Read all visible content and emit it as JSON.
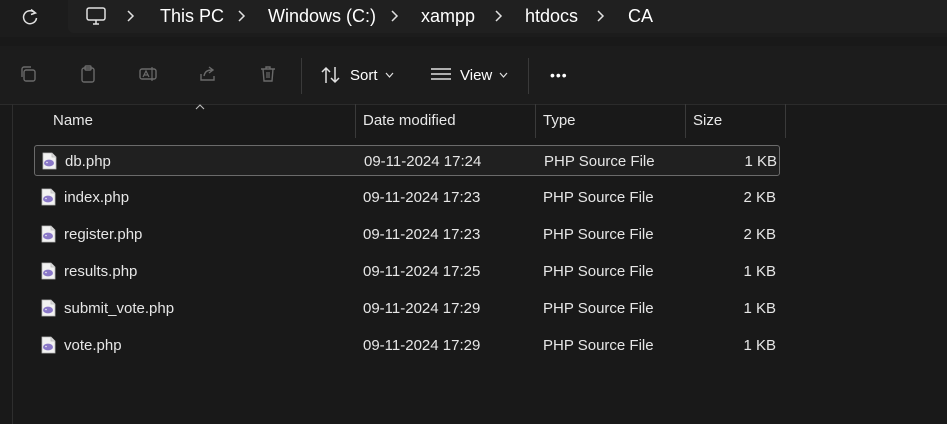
{
  "address_bar": {
    "root_icon": "computer-icon",
    "crumbs": [
      "This PC",
      "Windows (C:)",
      "xampp",
      "htdocs",
      "CA"
    ]
  },
  "toolbar": {
    "icons": [
      "copy-icon",
      "paste-icon",
      "rename-icon",
      "share-icon",
      "delete-icon"
    ],
    "sort_label": "Sort",
    "view_label": "View",
    "more_label": "•••"
  },
  "columns": {
    "name": "Name",
    "date_modified": "Date modified",
    "type": "Type",
    "size": "Size"
  },
  "files": [
    {
      "name": "db.php",
      "date": "09-11-2024 17:24",
      "type": "PHP Source File",
      "size": "1 KB",
      "selected": true
    },
    {
      "name": "index.php",
      "date": "09-11-2024 17:23",
      "type": "PHP Source File",
      "size": "2 KB"
    },
    {
      "name": "register.php",
      "date": "09-11-2024 17:23",
      "type": "PHP Source File",
      "size": "2 KB"
    },
    {
      "name": "results.php",
      "date": "09-11-2024 17:25",
      "type": "PHP Source File",
      "size": "1 KB"
    },
    {
      "name": "submit_vote.php",
      "date": "09-11-2024 17:29",
      "type": "PHP Source File",
      "size": "1 KB"
    },
    {
      "name": "vote.php",
      "date": "09-11-2024 17:29",
      "type": "PHP Source File",
      "size": "1 KB"
    }
  ],
  "colors": {
    "background": "#191919",
    "php_icon": "#8a78c8",
    "text": "#e6e6e6"
  }
}
